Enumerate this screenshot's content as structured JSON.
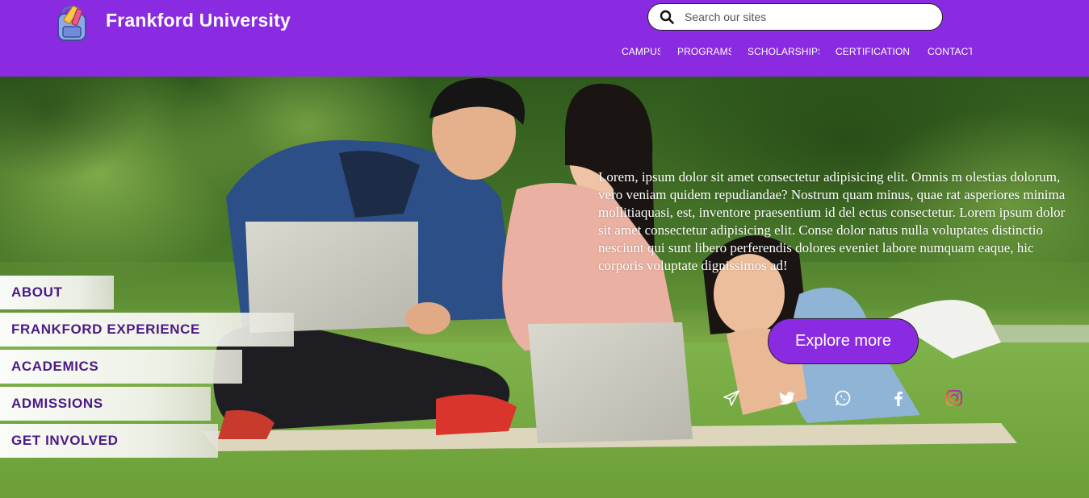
{
  "header": {
    "brand": "Frankford University",
    "logo_icon": "backpack-icon",
    "search": {
      "placeholder": "Search our sites",
      "value": ""
    },
    "nav": [
      {
        "label": "CAMPUS"
      },
      {
        "label": "PROGRAMS"
      },
      {
        "label": "SCHOLARSHIPS"
      },
      {
        "label": "CERTIFICATIONS"
      },
      {
        "label": "CONTACT"
      }
    ]
  },
  "hero": {
    "text": "Lorem, ipsum dolor sit amet consectetur adipisicing elit. Omnis m olestias dolorum, vero veniam quidem repudiandae? Nostrum quam minus, quae rat asperiores minima mollitiaquasi, est, inventore praesentium id del ectus consectetur. Lorem ipsum dolor sit amet consectetur adipisicing elit. Conse dolor natus nulla voluptates distinctio nesciunt qui sunt libero perferendis dolores eveniet labore numquam eaque, hic corporis voluptate dignissimos ad!",
    "button_label": "Explore more",
    "social_icons": [
      "send-icon",
      "twitter-icon",
      "whatsapp-icon",
      "facebook-icon",
      "instagram-icon"
    ]
  },
  "side_menu": [
    {
      "label": "ABOUT"
    },
    {
      "label": "FRANKFORD EXPERIENCE"
    },
    {
      "label": "ACADEMICS"
    },
    {
      "label": "ADMISSIONS"
    },
    {
      "label": "GET INVOLVED"
    }
  ],
  "colors": {
    "accent": "#8a2be2",
    "menu_text": "#4b1a85",
    "white": "#ffffff"
  }
}
